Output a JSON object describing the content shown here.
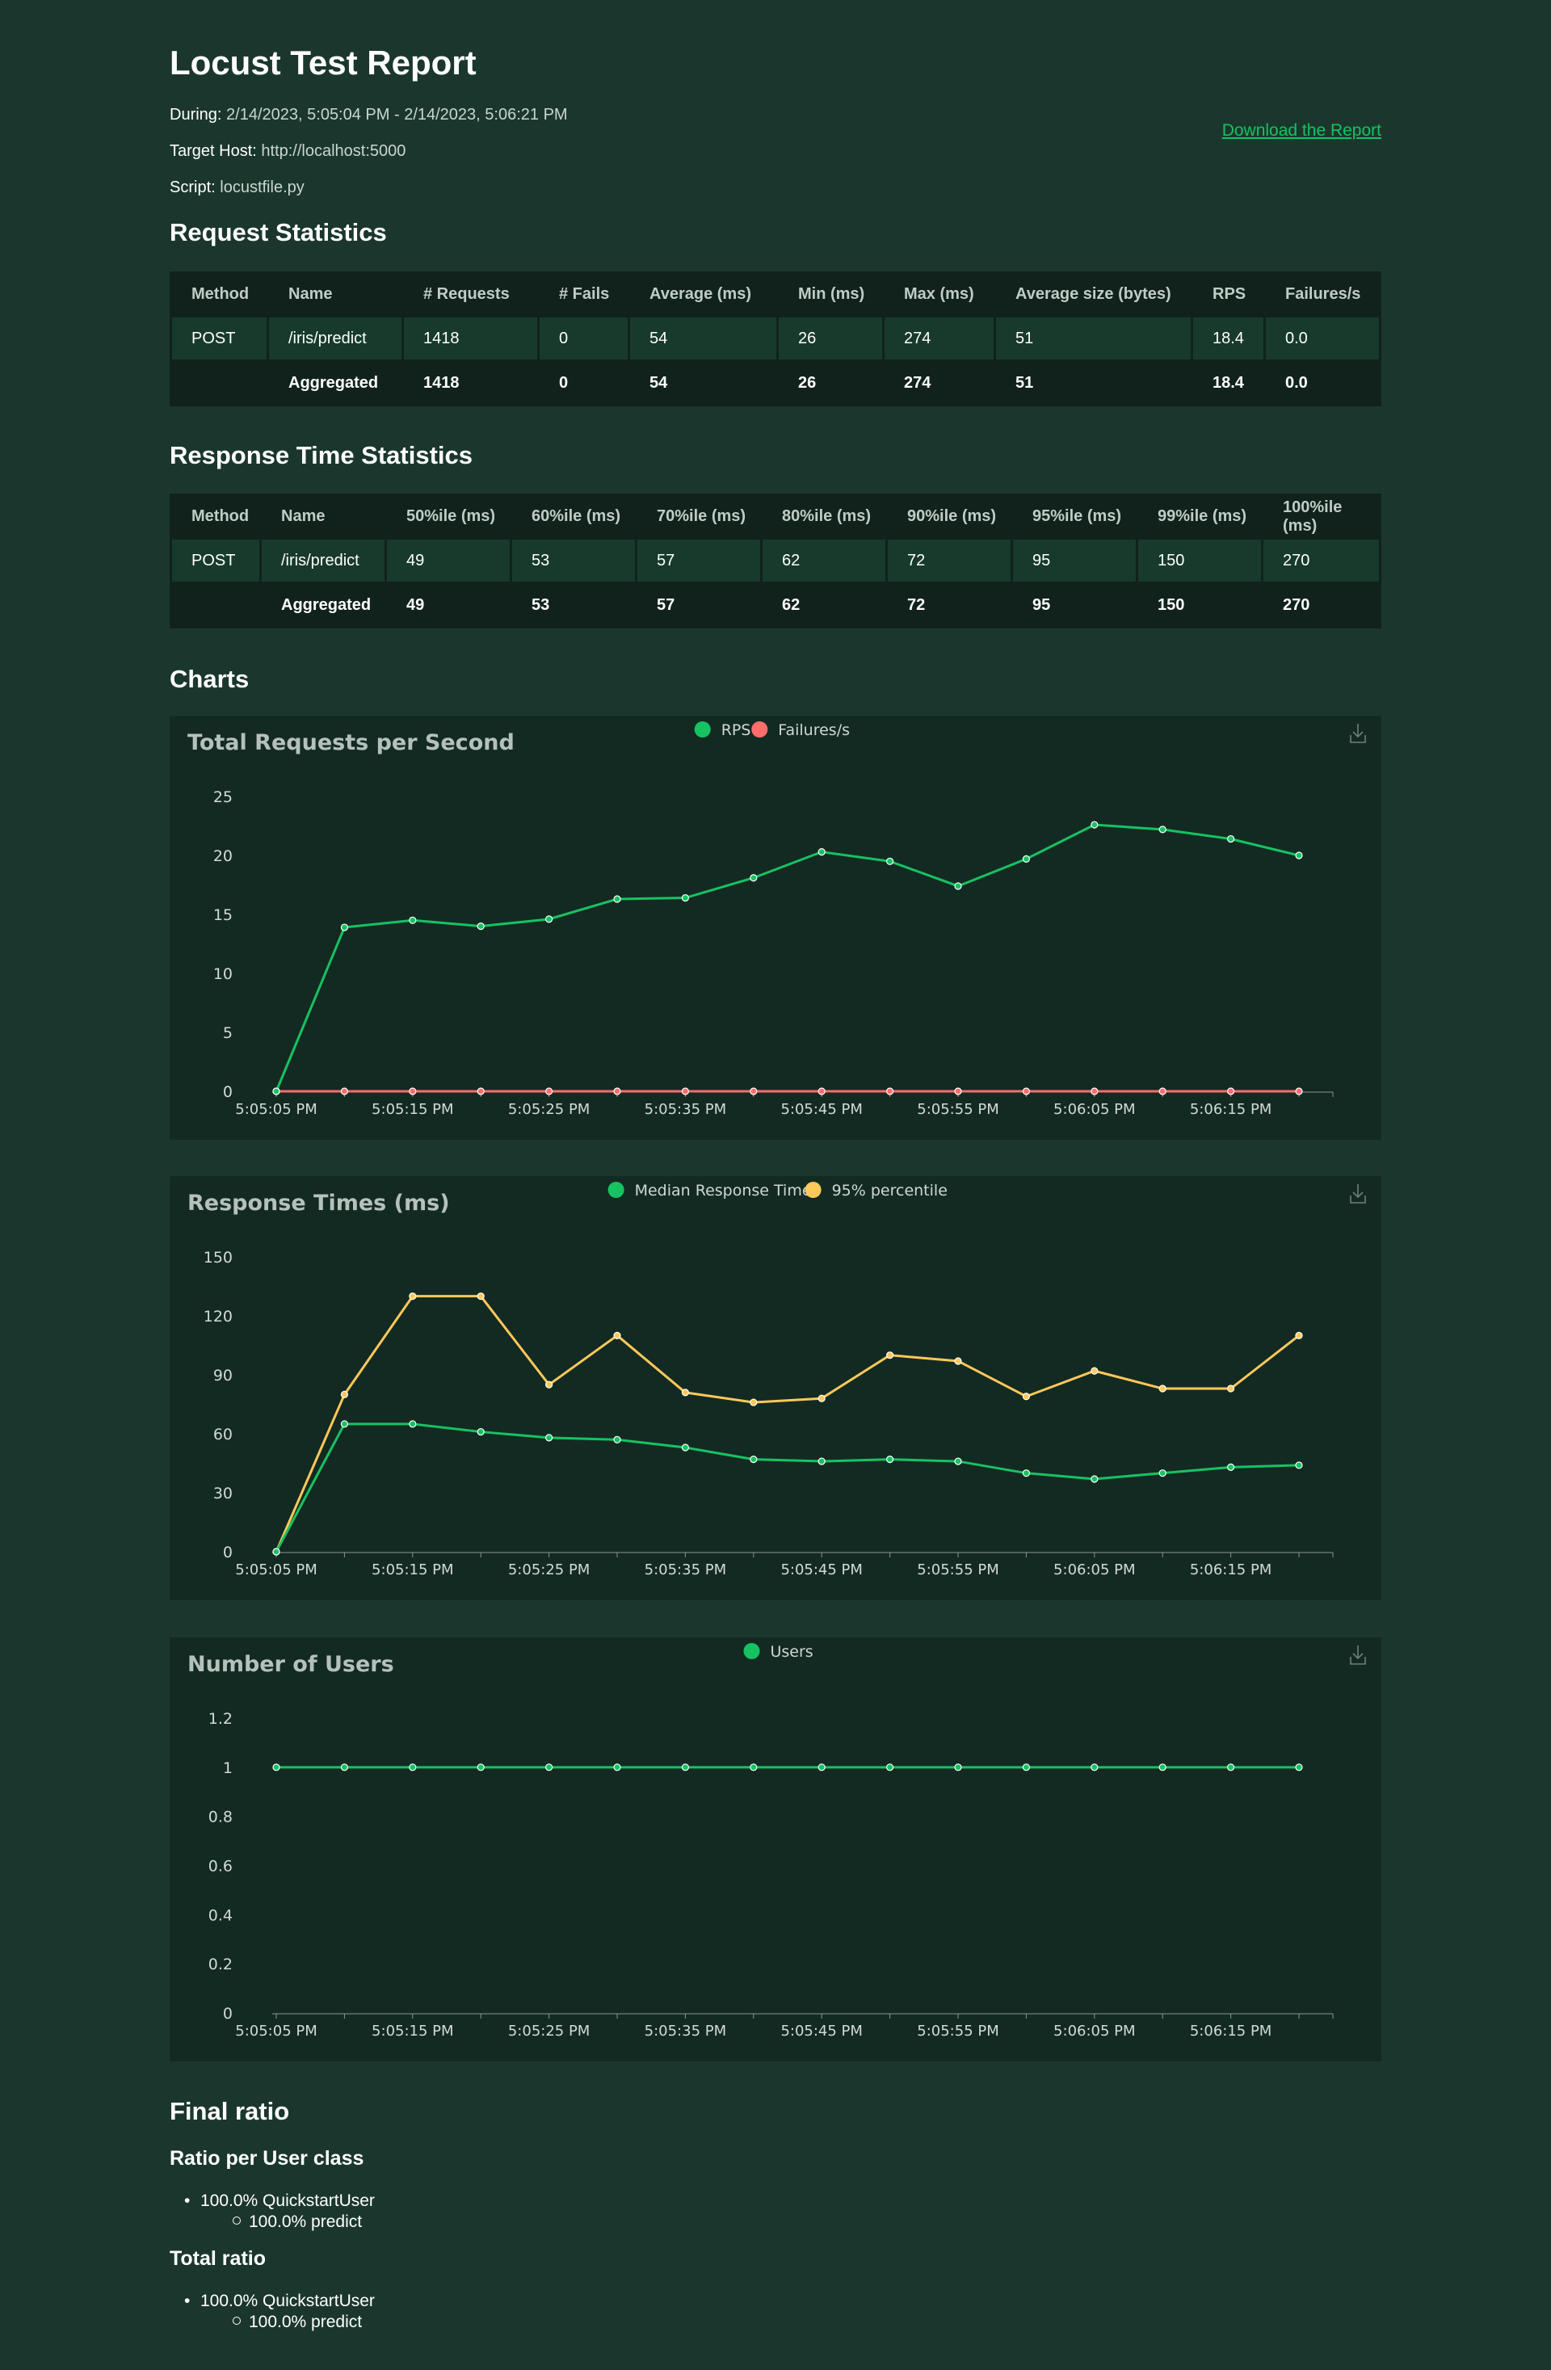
{
  "header": {
    "title": "Locust Test Report",
    "during_label": "During:",
    "during_value": "2/14/2023, 5:05:04 PM - 2/14/2023, 5:06:21 PM",
    "host_label": "Target Host:",
    "host_value": "http://localhost:5000",
    "script_label": "Script:",
    "script_value": "locustfile.py",
    "download_label": "Download the Report"
  },
  "request_stats": {
    "heading": "Request Statistics",
    "columns": [
      "Method",
      "Name",
      "# Requests",
      "# Fails",
      "Average (ms)",
      "Min (ms)",
      "Max (ms)",
      "Average size (bytes)",
      "RPS",
      "Failures/s"
    ],
    "rows": [
      [
        "POST",
        "/iris/predict",
        "1418",
        "0",
        "54",
        "26",
        "274",
        "51",
        "18.4",
        "0.0"
      ]
    ],
    "aggregated": [
      "",
      "Aggregated",
      "1418",
      "0",
      "54",
      "26",
      "274",
      "51",
      "18.4",
      "0.0"
    ]
  },
  "response_stats": {
    "heading": "Response Time Statistics",
    "columns": [
      "Method",
      "Name",
      "50%ile (ms)",
      "60%ile (ms)",
      "70%ile (ms)",
      "80%ile (ms)",
      "90%ile (ms)",
      "95%ile (ms)",
      "99%ile (ms)",
      "100%ile (ms)"
    ],
    "rows": [
      [
        "POST",
        "/iris/predict",
        "49",
        "53",
        "57",
        "62",
        "72",
        "95",
        "150",
        "270"
      ]
    ],
    "aggregated": [
      "",
      "Aggregated",
      "49",
      "53",
      "57",
      "62",
      "72",
      "95",
      "150",
      "270"
    ]
  },
  "charts_heading": "Charts",
  "chart_data": [
    {
      "type": "line",
      "title": "Total Requests per Second",
      "x": [
        "5:05:05 PM",
        "5:05:10 PM",
        "5:05:15 PM",
        "5:05:20 PM",
        "5:05:25 PM",
        "5:05:30 PM",
        "5:05:35 PM",
        "5:05:40 PM",
        "5:05:45 PM",
        "5:05:50 PM",
        "5:05:55 PM",
        "5:06:00 PM",
        "5:06:05 PM",
        "5:06:10 PM",
        "5:06:15 PM",
        "5:06:20 PM"
      ],
      "x_tick_labels": [
        "5:05:05 PM",
        "5:05:15 PM",
        "5:05:25 PM",
        "5:05:35 PM",
        "5:05:45 PM",
        "5:05:55 PM",
        "5:06:05 PM",
        "5:06:15 PM"
      ],
      "ylim": [
        0,
        25
      ],
      "y_ticks": [
        "0",
        "5",
        "10",
        "15",
        "20",
        "25"
      ],
      "series": [
        {
          "name": "RPS",
          "color": "#17c262",
          "values": [
            0,
            13.9,
            14.5,
            14.0,
            14.6,
            16.3,
            16.4,
            18.1,
            20.3,
            19.5,
            17.4,
            19.7,
            22.6,
            22.2,
            21.4,
            20.0
          ]
        },
        {
          "name": "Failures/s",
          "color": "#ff6d6d",
          "values": [
            0,
            0,
            0,
            0,
            0,
            0,
            0,
            0,
            0,
            0,
            0,
            0,
            0,
            0,
            0,
            0
          ]
        }
      ],
      "legend": "top-center",
      "grid": false
    },
    {
      "type": "line",
      "title": "Response Times (ms)",
      "x": [
        "5:05:05 PM",
        "5:05:10 PM",
        "5:05:15 PM",
        "5:05:20 PM",
        "5:05:25 PM",
        "5:05:30 PM",
        "5:05:35 PM",
        "5:05:40 PM",
        "5:05:45 PM",
        "5:05:50 PM",
        "5:05:55 PM",
        "5:06:00 PM",
        "5:06:05 PM",
        "5:06:10 PM",
        "5:06:15 PM",
        "5:06:20 PM"
      ],
      "x_tick_labels": [
        "5:05:05 PM",
        "5:05:15 PM",
        "5:05:25 PM",
        "5:05:35 PM",
        "5:05:45 PM",
        "5:05:55 PM",
        "5:06:05 PM",
        "5:06:15 PM"
      ],
      "ylim": [
        0,
        150
      ],
      "y_ticks": [
        "0",
        "30",
        "60",
        "90",
        "120",
        "150"
      ],
      "series": [
        {
          "name": "Median Response Time",
          "color": "#17c262",
          "values": [
            0,
            65,
            65,
            61,
            58,
            57,
            53,
            47,
            46,
            47,
            46,
            40,
            37,
            40,
            43,
            44
          ]
        },
        {
          "name": "95% percentile",
          "color": "#ffc85a",
          "values": [
            0,
            80,
            130,
            130,
            85,
            110,
            81,
            76,
            78,
            100,
            97,
            79,
            92,
            83,
            83,
            110
          ]
        }
      ],
      "legend": "top-center",
      "grid": false
    },
    {
      "type": "line",
      "title": "Number of Users",
      "x": [
        "5:05:05 PM",
        "5:05:10 PM",
        "5:05:15 PM",
        "5:05:20 PM",
        "5:05:25 PM",
        "5:05:30 PM",
        "5:05:35 PM",
        "5:05:40 PM",
        "5:05:45 PM",
        "5:05:50 PM",
        "5:05:55 PM",
        "5:06:00 PM",
        "5:06:05 PM",
        "5:06:10 PM",
        "5:06:15 PM",
        "5:06:20 PM"
      ],
      "x_tick_labels": [
        "5:05:05 PM",
        "5:05:15 PM",
        "5:05:25 PM",
        "5:05:35 PM",
        "5:05:45 PM",
        "5:05:55 PM",
        "5:06:05 PM",
        "5:06:15 PM"
      ],
      "ylim": [
        0,
        1.2
      ],
      "y_ticks": [
        "0",
        "0.2",
        "0.4",
        "0.6",
        "0.8",
        "1",
        "1.2"
      ],
      "series": [
        {
          "name": "Users",
          "color": "#17c262",
          "values": [
            1,
            1,
            1,
            1,
            1,
            1,
            1,
            1,
            1,
            1,
            1,
            1,
            1,
            1,
            1,
            1
          ]
        }
      ],
      "legend": "top-center",
      "grid": false
    }
  ],
  "final_ratio": {
    "heading": "Final ratio",
    "per_class_heading": "Ratio per User class",
    "per_class": {
      "user": "100.0% QuickstartUser",
      "task": "100.0% predict"
    },
    "total_heading": "Total ratio",
    "total": {
      "user": "100.0% QuickstartUser",
      "task": "100.0% predict"
    }
  },
  "icons": {
    "download": "download-icon"
  }
}
